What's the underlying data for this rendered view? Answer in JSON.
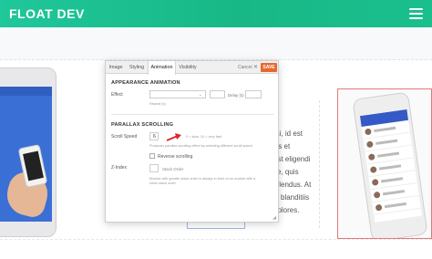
{
  "header": {
    "logo": "FLOAT DEV",
    "menu_icon": "hamburger-icon"
  },
  "dialog": {
    "tabs": [
      {
        "label": "Image"
      },
      {
        "label": "Styling"
      },
      {
        "label": "Animation",
        "active": true
      },
      {
        "label": "Visibility"
      }
    ],
    "cancel_label": "Cancel",
    "save_label": "SAVE",
    "appearance": {
      "heading": "APPEARANCE ANIMATION",
      "effect_label": "Effect",
      "delay_label": "Delay (s)",
      "repeat_label": "Repeat (s)"
    },
    "parallax": {
      "heading": "PARALLAX SCROLLING",
      "speed_label": "Scroll Speed",
      "speed_value": "6",
      "speed_hint": "0 = slow, 10 = very fast",
      "speed_desc": "Produces parallax scrolling effect by selecting different scroll speed",
      "reverse_label": "Reverse scrolling",
      "zindex_label": "Z-Index",
      "zindex_placeholder": "Stack Order",
      "zindex_desc_1": "Module with greater stack order is always in front of an module with a",
      "zindex_desc_2": "lower stack order"
    }
  },
  "background_text": [
    "mi, id est",
    "ilis et",
    "est eligendi",
    "ce, quis",
    "ellendus. At",
    "is blanditiis",
    "dolores."
  ],
  "colors": {
    "header_green": "#1fc79a",
    "save_orange": "#e8692c",
    "arrow_red": "#d9272e"
  }
}
